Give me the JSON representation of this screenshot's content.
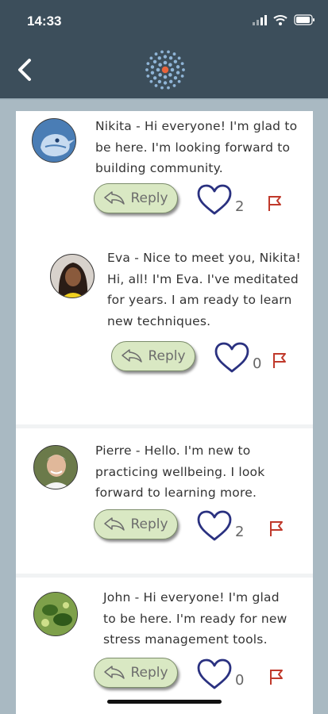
{
  "status_bar": {
    "time": "14:33"
  },
  "header": {
    "back_icon": "chevron-left-icon",
    "logo_icon": "dotted-circle-logo"
  },
  "colors": {
    "header": "#3c4e5b",
    "reply_bg": "#d9e8c3",
    "heart": "#2a3180",
    "flag": "#c0392b"
  },
  "comments": [
    {
      "author": "Nikita",
      "avatar": "bird-avatar",
      "lines": [
        "Nikita - Hi everyone! I'm glad to",
        "be here. I'm looking forward to",
        "building community."
      ],
      "reply_label": "Reply",
      "likes": "2"
    },
    {
      "author": "Eva",
      "avatar": "photo-avatar",
      "lines": [
        "Eva - Nice to meet you, Nikita!",
        "Hi, all! I'm Eva. I've meditated",
        "for years. I am ready to learn",
        "new techniques."
      ],
      "reply_label": "Reply",
      "likes": "0"
    },
    {
      "author": "Pierre",
      "avatar": "photo-avatar",
      "lines": [
        "Pierre - Hello. I'm new to",
        "practicing wellbeing. I look",
        "forward to learning more."
      ],
      "reply_label": "Reply",
      "likes": "2"
    },
    {
      "author": "John",
      "avatar": "leaf-avatar",
      "lines": [
        "John - Hi everyone! I'm glad",
        "to be here. I'm ready for new",
        "stress management tools."
      ],
      "reply_label": "Reply",
      "likes": "0"
    }
  ]
}
